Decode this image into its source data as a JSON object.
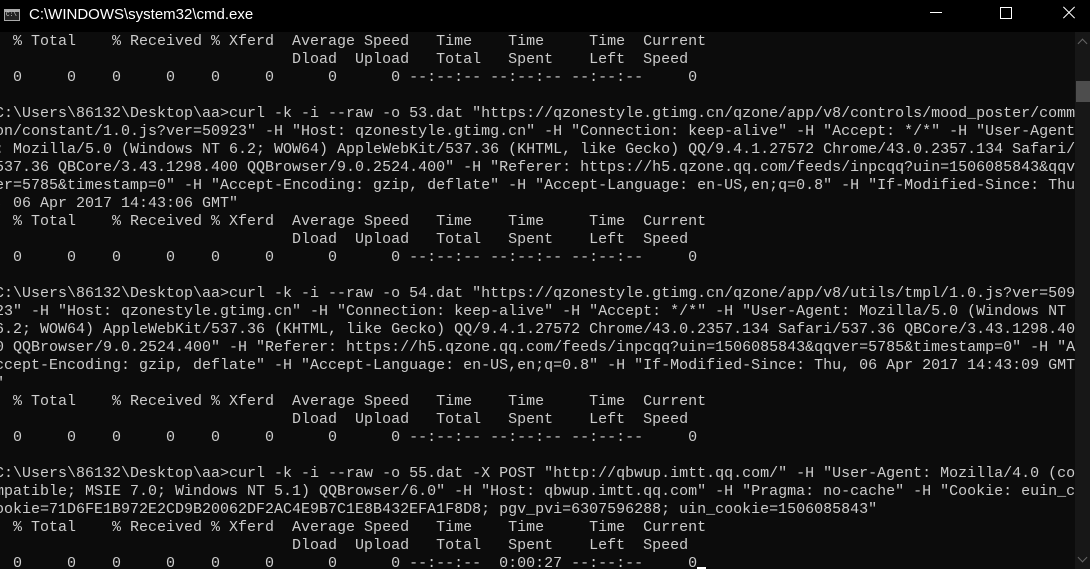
{
  "window": {
    "title": "C:\\WINDOWS\\system32\\cmd.exe",
    "icon": "cmd-icon",
    "controls": [
      "minimize-icon",
      "maximize-icon",
      "close-icon"
    ]
  },
  "colors": {
    "background": "#0c0c0c",
    "text": "#cccccc",
    "titlebar": "#000000"
  },
  "console": {
    "lines": [
      "  % Total    % Received % Xferd  Average Speed   Time    Time     Time  Current",
      "                                 Dload  Upload   Total   Spent    Left  Speed",
      "  0     0    0     0    0     0      0      0 --:--:-- --:--:-- --:--:--     0",
      "",
      "C:\\Users\\86132\\Desktop\\aa>curl -k -i --raw -o 53.dat \"https://qzonestyle.gtimg.cn/qzone/app/v8/controls/mood_poster/comm",
      "on/constant/1.0.js?ver=50923\" -H \"Host: qzonestyle.gtimg.cn\" -H \"Connection: keep-alive\" -H \"Accept: */*\" -H \"User-Agent",
      ": Mozilla/5.0 (Windows NT 6.2; WOW64) AppleWebKit/537.36 (KHTML, like Gecko) QQ/9.4.1.27572 Chrome/43.0.2357.134 Safari/",
      "537.36 QBCore/3.43.1298.400 QQBrowser/9.0.2524.400\" -H \"Referer: https://h5.qzone.qq.com/feeds/inpcqq?uin=1506085843&qqv",
      "er=5785&timestamp=0\" -H \"Accept-Encoding: gzip, deflate\" -H \"Accept-Language: en-US,en;q=0.8\" -H \"If-Modified-Since: Thu",
      ", 06 Apr 2017 14:43:06 GMT\"",
      "  % Total    % Received % Xferd  Average Speed   Time    Time     Time  Current",
      "                                 Dload  Upload   Total   Spent    Left  Speed",
      "  0     0    0     0    0     0      0      0 --:--:-- --:--:-- --:--:--     0",
      "",
      "C:\\Users\\86132\\Desktop\\aa>curl -k -i --raw -o 54.dat \"https://qzonestyle.gtimg.cn/qzone/app/v8/utils/tmpl/1.0.js?ver=509",
      "23\" -H \"Host: qzonestyle.gtimg.cn\" -H \"Connection: keep-alive\" -H \"Accept: */*\" -H \"User-Agent: Mozilla/5.0 (Windows NT ",
      "6.2; WOW64) AppleWebKit/537.36 (KHTML, like Gecko) QQ/9.4.1.27572 Chrome/43.0.2357.134 Safari/537.36 QBCore/3.43.1298.40",
      "0 QQBrowser/9.0.2524.400\" -H \"Referer: https://h5.qzone.qq.com/feeds/inpcqq?uin=1506085843&qqver=5785&timestamp=0\" -H \"A",
      "ccept-Encoding: gzip, deflate\" -H \"Accept-Language: en-US,en;q=0.8\" -H \"If-Modified-Since: Thu, 06 Apr 2017 14:43:09 GMT",
      "\"",
      "  % Total    % Received % Xferd  Average Speed   Time    Time     Time  Current",
      "                                 Dload  Upload   Total   Spent    Left  Speed",
      "  0     0    0     0    0     0      0      0 --:--:-- --:--:-- --:--:--     0",
      "",
      "C:\\Users\\86132\\Desktop\\aa>curl -k -i --raw -o 55.dat -X POST \"http://qbwup.imtt.qq.com/\" -H \"User-Agent: Mozilla/4.0 (co",
      "mpatible; MSIE 7.0; Windows NT 5.1) QQBrowser/6.0\" -H \"Host: qbwup.imtt.qq.com\" -H \"Pragma: no-cache\" -H \"Cookie: euin_c",
      "ookie=71D6FE1B972E2CD9B20062DF2AC4E9B7C1E8B432EFA1F8D8; pgv_pvi=6307596288; uin_cookie=1506085843\"",
      "  % Total    % Received % Xferd  Average Speed   Time    Time     Time  Current",
      "                                 Dload  Upload   Total   Spent    Left  Speed",
      "  0     0    0     0    0     0      0      0 --:--:--  0:00:27 --:--:--     0"
    ]
  },
  "scrollbar": {
    "position_fraction": 0.1
  }
}
